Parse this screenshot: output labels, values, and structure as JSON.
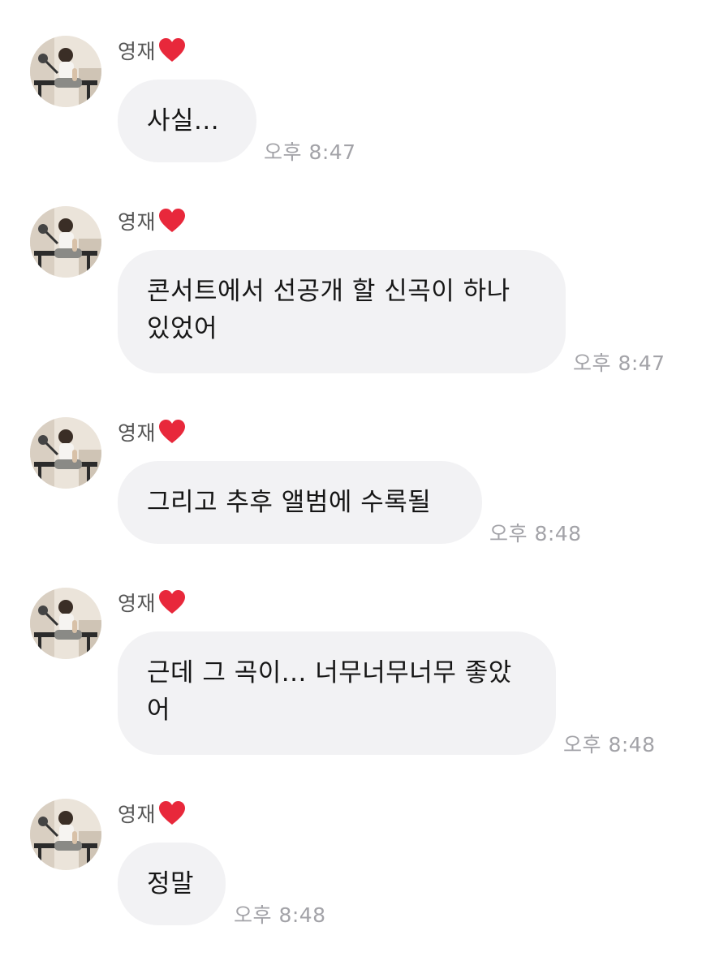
{
  "messages": [
    {
      "sender": "영재",
      "text": "사실...",
      "time": "오후 8:47",
      "avatar": "profile-photo"
    },
    {
      "sender": "영재",
      "text": "콘서트에서 선공개 할 신곡이 하나 있었어",
      "time": "오후 8:47",
      "avatar": "profile-photo"
    },
    {
      "sender": "영재",
      "text": "그리고 추후 앨범에 수록될",
      "time": "오후 8:48",
      "avatar": "profile-photo"
    },
    {
      "sender": "영재",
      "text": "근데 그 곡이... 너무너무너무 좋았어",
      "time": "오후 8:48",
      "avatar": "profile-photo"
    },
    {
      "sender": "영재",
      "text": "정말",
      "time": "오후 8:48",
      "avatar": "profile-photo"
    }
  ],
  "icons": {
    "heart": "red-heart-icon"
  },
  "colors": {
    "bubble": "#f2f2f4",
    "timestamp": "#a3a3a8",
    "heart": "#e8283b"
  }
}
